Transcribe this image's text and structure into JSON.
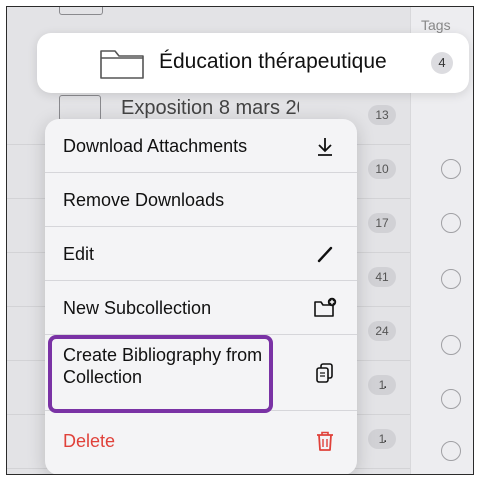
{
  "background": {
    "partial_row_title": "Exposition 8 mars 20",
    "counts": [
      "13",
      "10",
      "17",
      "41",
      "24",
      "1",
      "1"
    ],
    "tags_header": "Tags"
  },
  "highlighted_collection": {
    "title": "Éducation thérapeutique",
    "count": "4"
  },
  "menu": {
    "download_attachments": "Download Attachments",
    "remove_downloads": "Remove Downloads",
    "edit": "Edit",
    "new_subcollection": "New Subcollection",
    "create_bibliography": "Create Bibliography from Collection",
    "delete": "Delete"
  },
  "colors": {
    "highlight_border": "#7a32a5",
    "delete_red": "#e0413a"
  },
  "icons": {
    "download_attachments": "download-icon",
    "edit": "pencil-icon",
    "new_subcollection": "folder-plus-icon",
    "create_bibliography": "copy-document-icon",
    "delete": "trash-icon"
  }
}
